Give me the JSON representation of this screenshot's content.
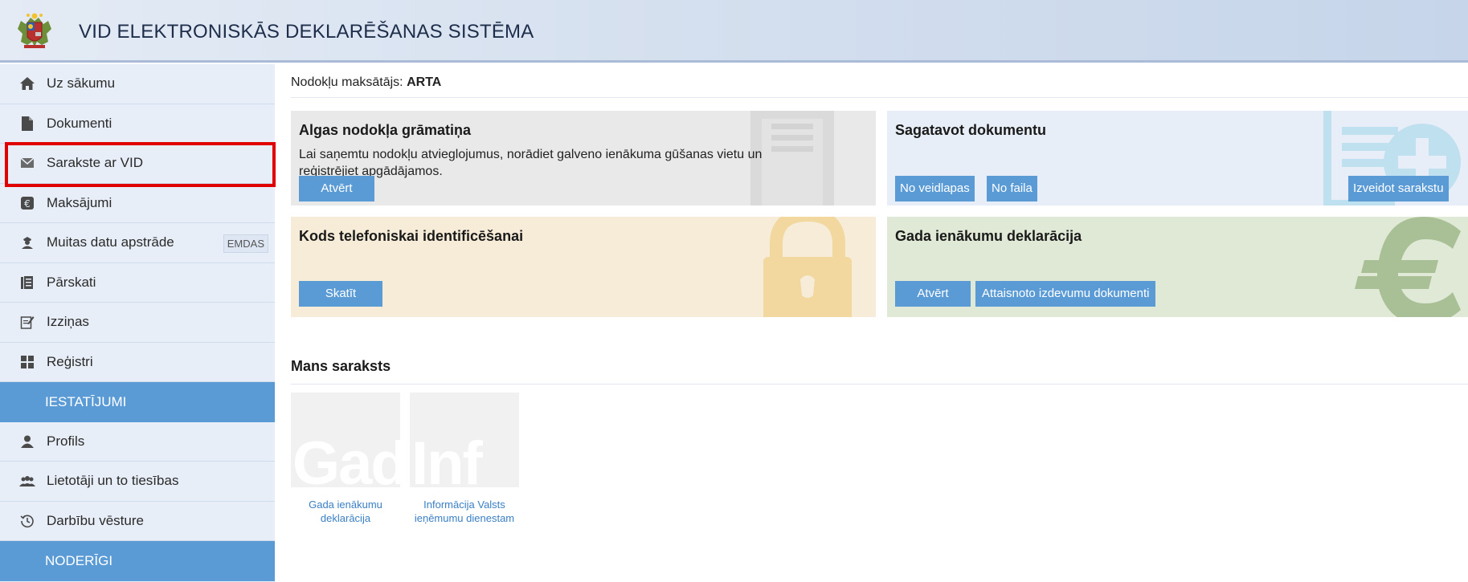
{
  "header": {
    "title": "VID ELEKTRONISKĀS DEKLARĒŠANAS SISTĒMA",
    "logo_icon": "latvia-coat-of-arms-icon"
  },
  "sidebar": {
    "items": [
      {
        "label": "Uz sākumu",
        "icon": "home-icon"
      },
      {
        "label": "Dokumenti",
        "icon": "document-icon"
      },
      {
        "label": "Sarakste ar VID",
        "icon": "envelope-icon",
        "highlighted": true
      },
      {
        "label": "Maksājumi",
        "icon": "euro-coin-icon"
      },
      {
        "label": "Muitas datu apstrāde",
        "icon": "customs-officer-icon",
        "badge": "EMDAS"
      },
      {
        "label": "Pārskati",
        "icon": "reports-icon"
      },
      {
        "label": "Izziņas",
        "icon": "certificate-edit-icon"
      },
      {
        "label": "Reģistri",
        "icon": "grid-icon"
      }
    ],
    "section_settings": "IESTATĪJUMI",
    "settings_items": [
      {
        "label": "Profils",
        "icon": "user-icon"
      },
      {
        "label": "Lietotāji un to tiesības",
        "icon": "users-icon"
      },
      {
        "label": "Darbību vēsture",
        "icon": "history-icon"
      }
    ],
    "section_useful": "NODERĪGI"
  },
  "main": {
    "taxpayer_label": "Nodokļu maksātājs:",
    "taxpayer_name": "ARTA",
    "cards": {
      "algas": {
        "title": "Algas nodokļa grāmatiņa",
        "text": "Lai saņemtu nodokļu atvieglojumus, norādiet galveno ienākuma gūšanas vietu un reģistrējiet apgādājamos.",
        "button": "Atvērt",
        "color": "#e9e9e9"
      },
      "sagatavot": {
        "title": "Sagatavot dokumentu",
        "btn_form": "No veidlapas",
        "btn_file": "No faila",
        "btn_create": "Izveidot sarakstu",
        "color": "#e8eef7"
      },
      "kods": {
        "title": "Kods telefoniskai identificēšanai",
        "button": "Skatīt",
        "color": "#f7ecd8"
      },
      "gada": {
        "title": "Gada ienākumu deklarācija",
        "btn_open": "Atvērt",
        "btn_docs": "Attaisnoto izdevumu dokumenti",
        "color": "#dfe9d6"
      }
    },
    "my_list_title": "Mans saraksts",
    "tiles": [
      {
        "thumb_text": "Gad",
        "caption_1": "Gada ienākumu",
        "caption_2": "deklarācija"
      },
      {
        "thumb_text": "Inf",
        "caption_1": "Informācija Valsts",
        "caption_2": "ieņēmumu dienestam"
      }
    ]
  }
}
